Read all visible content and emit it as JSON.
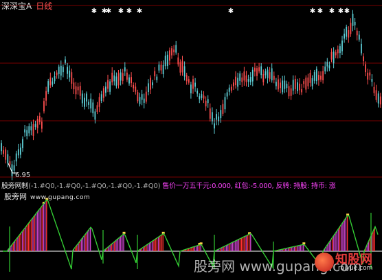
{
  "header": {
    "stock_name": "深深宝A",
    "timeframe": "日线"
  },
  "chart": {
    "low_price_label": "6.95",
    "colors": {
      "up": "#ff4f4f",
      "down": "#5fd0d8",
      "grid": "#7a0000",
      "ind_magenta": "#cc44cc",
      "ind_red": "#ff3030",
      "ind_green": "#33cc33",
      "ind_white": "#ffffff",
      "ind_yellow": "#ffd24a"
    }
  },
  "indicator_header": {
    "name": "股旁网制",
    "params": "(-1.#Q0,-1.#Q0,-1.#Q0,-1.#Q0,-1.#Q0)",
    "sell_label": "售价一万五千元:",
    "sell_value": "0.000,",
    "red_label": "红包:",
    "red_value": "-5.000,",
    "rev_label": "反转:",
    "hold_label": "持股:",
    "hold2_label": "持币:",
    "cut": "涨"
  },
  "site_label": {
    "name": "股旁网",
    "url": "www.gupang.com"
  },
  "watermark": {
    "text": "股旁网 www.gupang.com",
    "logo_text": "知股网",
    "logo_url": "raiyue.com"
  }
}
